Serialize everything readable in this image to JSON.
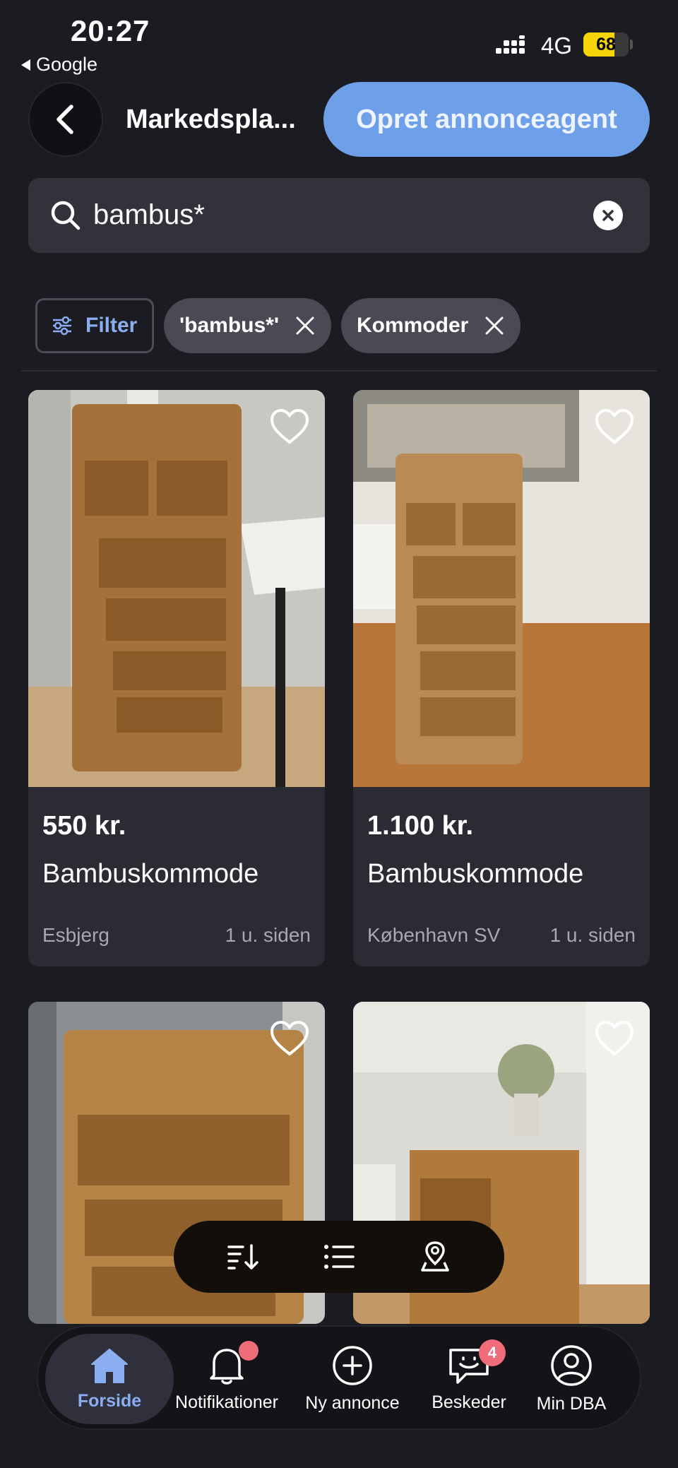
{
  "status_bar": {
    "time": "20:27",
    "back_app": "Google",
    "network": "4G",
    "battery_level": "68",
    "battery_fraction": 0.68,
    "battery_color": "#f5d50a"
  },
  "header": {
    "title": "Markedspla...",
    "agent_button": "Opret annonceagent",
    "accent_color": "#6e9fe9"
  },
  "search": {
    "value": "bambus*",
    "icon": "search-icon",
    "clear_icon": "clear-icon"
  },
  "chips": {
    "filter_label": "Filter",
    "active": [
      {
        "label": "'bambus*'"
      },
      {
        "label": "Kommoder"
      }
    ]
  },
  "listings": [
    {
      "price": "550 kr.",
      "title": "Bambuskommode",
      "location": "Esbjerg",
      "age": "1 u. siden"
    },
    {
      "price": "1.100 kr.",
      "title": "Bambuskommode",
      "location": "København SV",
      "age": "1 u. siden"
    },
    {
      "price": "",
      "title": "",
      "location": "",
      "age": ""
    },
    {
      "price": "",
      "title": "",
      "location": "",
      "age": ""
    }
  ],
  "floating_toolbar": {
    "icons": [
      "sort-icon",
      "list-view-icon",
      "map-pin-icon"
    ]
  },
  "bottom_nav": {
    "items": [
      {
        "label": "Forside",
        "icon": "home-icon",
        "active": true
      },
      {
        "label": "Notifikationer",
        "icon": "bell-icon",
        "badge": ""
      },
      {
        "label": "Ny annonce",
        "icon": "plus-circle-icon"
      },
      {
        "label": "Beskeder",
        "icon": "chat-icon",
        "badge": "4"
      },
      {
        "label": "Min DBA",
        "icon": "profile-icon"
      }
    ],
    "active_color": "#8aaef0",
    "badge_color": "#f06c7a"
  }
}
